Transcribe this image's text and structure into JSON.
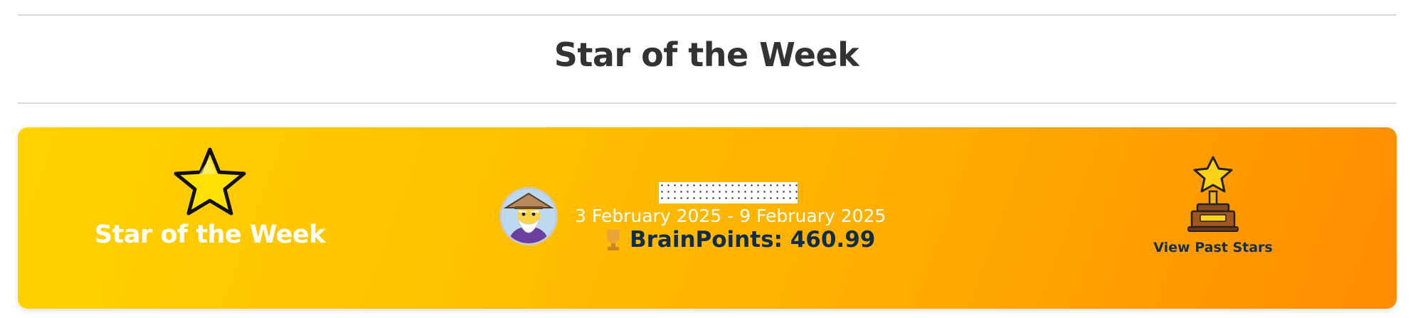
{
  "page": {
    "section_title": "Star of the Week"
  },
  "banner": {
    "badge_label": "Star of the Week",
    "winner": {
      "avatar_alt": "wizard-avatar",
      "date_range": "3 February 2025 - 9 February 2025",
      "points_label": "BrainPoints: 460.99",
      "points_icon": "trophy-icon"
    },
    "past_stars_label": "View Past Stars",
    "past_stars_icon": "star-trophy-icon"
  },
  "colors": {
    "banner_start": "#ffd200",
    "banner_end": "#ff8c00",
    "title_text": "#333333",
    "points_text": "#0f2c4a"
  }
}
